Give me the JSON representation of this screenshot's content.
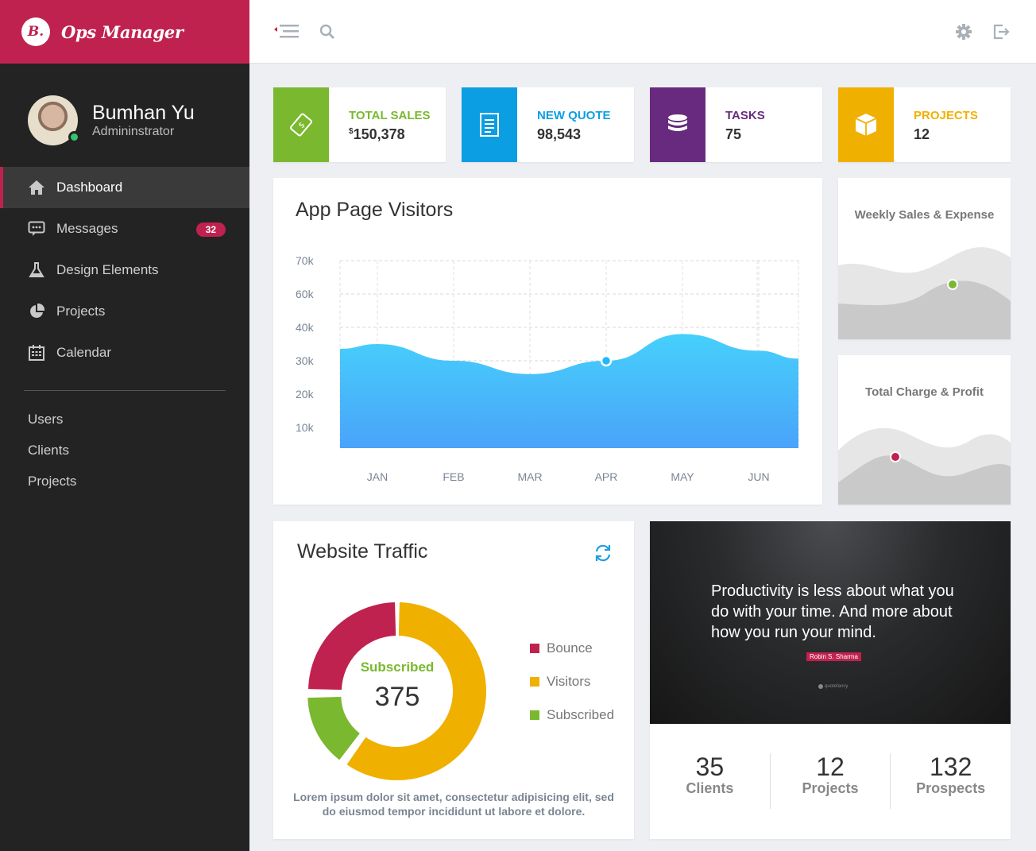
{
  "brand": {
    "logo": "B.",
    "name": "Ops Manager"
  },
  "profile": {
    "name": "Bumhan Yu",
    "role": "Admininstrator"
  },
  "nav": {
    "items": [
      {
        "label": "Dashboard",
        "icon": "home-icon"
      },
      {
        "label": "Messages",
        "icon": "chat-icon",
        "badge": "32"
      },
      {
        "label": "Design Elements",
        "icon": "flask-icon"
      },
      {
        "label": "Projects",
        "icon": "pie-icon"
      },
      {
        "label": "Calendar",
        "icon": "calendar-icon"
      }
    ],
    "secondary": [
      "Users",
      "Clients",
      "Projects"
    ]
  },
  "stats": [
    {
      "label": "TOTAL SALES",
      "currency": "$",
      "value": "150,378",
      "color": "#7ab82f",
      "icon": "money-icon"
    },
    {
      "label": "NEW QUOTE",
      "value": "98,543",
      "color": "#0c9ee2",
      "icon": "document-icon"
    },
    {
      "label": "TASKS",
      "value": "75",
      "color": "#682a7e",
      "icon": "database-icon"
    },
    {
      "label": "PROJECTS",
      "value": "12",
      "color": "#f0b000",
      "icon": "cube-icon"
    }
  ],
  "visitors": {
    "title": "App Page Visitors"
  },
  "chart_data": {
    "type": "area",
    "title": "App Page Visitors",
    "categories": [
      "JAN",
      "FEB",
      "MAR",
      "APR",
      "MAY",
      "JUN"
    ],
    "y_ticks": [
      "70k",
      "60k",
      "40k",
      "30k",
      "20k",
      "10k"
    ],
    "values": [
      35,
      30,
      26,
      30,
      38,
      33
    ],
    "highlight": "APR",
    "color": "#3fb3f7",
    "grid": true
  },
  "mini_charts": [
    {
      "title": "Weekly Sales & Expense",
      "dot_color": "#7ab82f"
    },
    {
      "title": "Total Charge & Profit",
      "dot_color": "#c0224f"
    }
  ],
  "traffic": {
    "title": "Website Traffic",
    "center_label": "Subscribed",
    "center_value": "375",
    "center_color": "#7ab82f",
    "legend": [
      {
        "label": "Bounce",
        "color": "#c0224f"
      },
      {
        "label": "Visitors",
        "color": "#f0b000"
      },
      {
        "label": "Subscribed",
        "color": "#7ab82f"
      }
    ],
    "segments": [
      {
        "name": "Bounce",
        "value": 25
      },
      {
        "name": "Visitors",
        "value": 60
      },
      {
        "name": "Subscribed",
        "value": 15
      }
    ],
    "description": "Lorem ipsum dolor sit amet, consectetur adipisicing elit, sed do eiusmod tempor incididunt ut labore et dolore."
  },
  "quote": {
    "text": "Productivity is less about what you do with your time. And more about how you run your mind.",
    "author": "Robin S. Sharma",
    "source": "quotefancy"
  },
  "counters": [
    {
      "value": "35",
      "label": "Clients"
    },
    {
      "value": "12",
      "label": "Projects"
    },
    {
      "value": "132",
      "label": "Prospects"
    }
  ]
}
